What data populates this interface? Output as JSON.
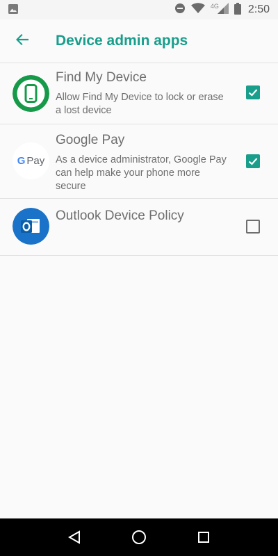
{
  "status_bar": {
    "time": "2:50",
    "network": "4G",
    "icons": [
      "image-icon",
      "do-not-disturb-icon",
      "wifi-icon",
      "signal-icon",
      "battery-icon"
    ]
  },
  "app_bar": {
    "title": "Device admin apps",
    "back_icon": "arrow-back-icon",
    "accent_color": "#199e8c"
  },
  "apps": [
    {
      "title": "Find My Device",
      "description": "Allow Find My Device to lock or erase a lost device",
      "icon": "find-my-device-icon",
      "checked": true
    },
    {
      "title": "Google Pay",
      "description": "As a device administrator, Google Pay can help make your phone more secure",
      "icon": "google-pay-icon",
      "icon_text": "G Pay",
      "checked": true
    },
    {
      "title": "Outlook Device Policy",
      "description": "",
      "icon": "outlook-icon",
      "icon_text": "O",
      "checked": false
    }
  ],
  "nav_bar": {
    "buttons": [
      "back-triangle-icon",
      "home-circle-icon",
      "recents-square-icon"
    ]
  }
}
